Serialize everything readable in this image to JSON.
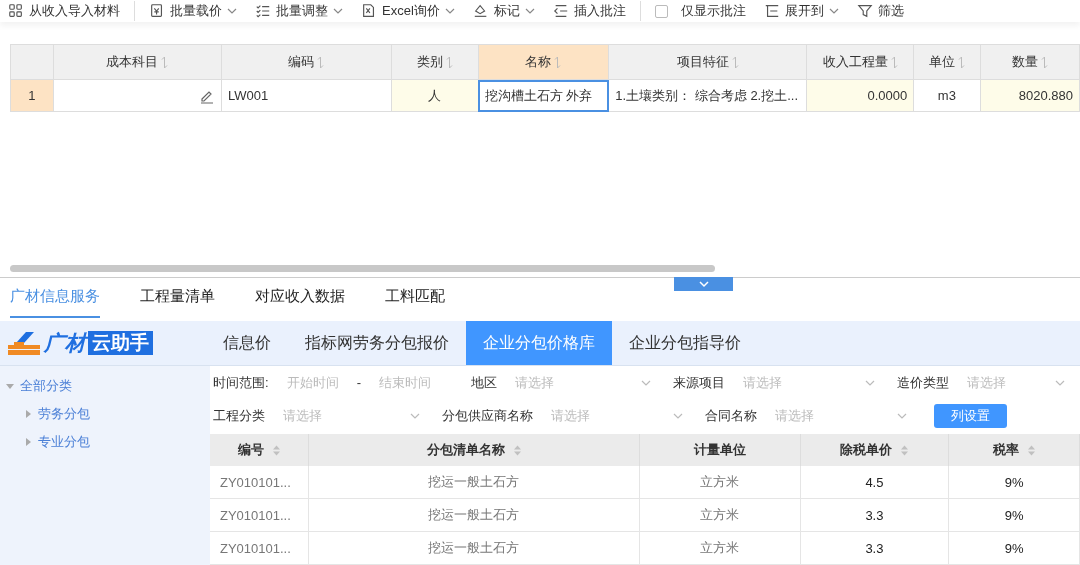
{
  "toolbar": {
    "groups": [
      [
        {
          "kind": "button",
          "label": "从收入导入材料",
          "caret": false
        }
      ],
      [
        {
          "kind": "button",
          "label": "批量载价",
          "caret": true
        },
        {
          "kind": "button",
          "label": "批量调整",
          "caret": true
        },
        {
          "kind": "button",
          "label": "Excel询价",
          "caret": true
        },
        {
          "kind": "button",
          "label": "标记",
          "caret": true
        },
        {
          "kind": "button",
          "label": "插入批注",
          "caret": false
        }
      ],
      [
        {
          "kind": "checkbox",
          "label": "仅显示批注",
          "checked": false
        },
        {
          "kind": "button",
          "label": "展开到",
          "caret": true
        },
        {
          "kind": "button",
          "label": "筛选",
          "caret": false
        }
      ]
    ]
  },
  "material_table": {
    "columns": [
      {
        "label": "成本科目",
        "selected": false,
        "editable": false
      },
      {
        "label": "编码",
        "selected": false,
        "editable": false
      },
      {
        "label": "类别",
        "selected": false,
        "editable": true
      },
      {
        "label": "名称",
        "selected": true,
        "editable": false
      },
      {
        "label": "项目特征",
        "selected": false,
        "editable": false
      },
      {
        "label": "收入工程量",
        "selected": false,
        "editable": true
      },
      {
        "label": "单位",
        "selected": false,
        "editable": false
      },
      {
        "label": "数量",
        "selected": false,
        "editable": true
      }
    ],
    "rows": [
      {
        "number": "1",
        "selected": true,
        "cells": [
          "",
          "LW001",
          "人",
          "挖沟槽土石方 外弃",
          "1.土壤类别： 综合考虑 2.挖土...",
          "0.0000",
          "m3",
          "8020.880"
        ]
      }
    ]
  },
  "bottom_tabs": [
    {
      "label": "广材信息服务",
      "selected": true
    },
    {
      "label": "工程量清单",
      "selected": false
    },
    {
      "label": "对应收入数据",
      "selected": false
    },
    {
      "label": "工料匹配",
      "selected": false
    }
  ],
  "guangcai": {
    "logo": {
      "brand": "广材",
      "product": "云助手"
    },
    "tabs": [
      {
        "label": "信息价",
        "selected": false
      },
      {
        "label": "指标网劳务分包报价",
        "selected": false
      },
      {
        "label": "企业分包价格库",
        "selected": true
      },
      {
        "label": "企业分包指导价",
        "selected": false
      }
    ],
    "category_tree": [
      {
        "label": "全部分类",
        "expanded": true,
        "children": [
          {
            "label": "劳务分包",
            "expanded": false
          },
          {
            "label": "专业分包",
            "expanded": false
          }
        ]
      }
    ],
    "filters": [
      [
        {
          "kind": "date_range",
          "label": "时间范围:",
          "start_placeholder": "开始时间",
          "separator": "-",
          "end_placeholder": "结束时间"
        },
        {
          "kind": "select",
          "label": "地区",
          "placeholder": "请选择"
        },
        {
          "kind": "select",
          "label": "来源项目",
          "placeholder": "请选择"
        },
        {
          "kind": "select",
          "label": "造价类型",
          "placeholder": "请选择"
        }
      ],
      [
        {
          "kind": "select",
          "label": "工程分类",
          "placeholder": "请选择"
        },
        {
          "kind": "select",
          "label": "分包供应商名称",
          "placeholder": "请选择"
        },
        {
          "kind": "select",
          "label": "合同名称",
          "placeholder": "请选择"
        },
        {
          "kind": "button",
          "label": "列设置"
        }
      ]
    ],
    "price_table": {
      "columns": [
        {
          "label": "编号",
          "sortable": true
        },
        {
          "label": "分包清单名称",
          "sortable": true
        },
        {
          "label": "计量单位",
          "sortable": false
        },
        {
          "label": "除税单价",
          "sortable": true
        },
        {
          "label": "税率",
          "sortable": true
        }
      ],
      "rows": [
        [
          "ZY010101...",
          "挖运一般土石方",
          "立方米",
          "4.5",
          "9%"
        ],
        [
          "ZY010101...",
          "挖运一般土石方",
          "立方米",
          "3.3",
          "9%"
        ],
        [
          "ZY010101...",
          "挖运一般土石方",
          "立方米",
          "3.3",
          "9%"
        ]
      ]
    }
  }
}
